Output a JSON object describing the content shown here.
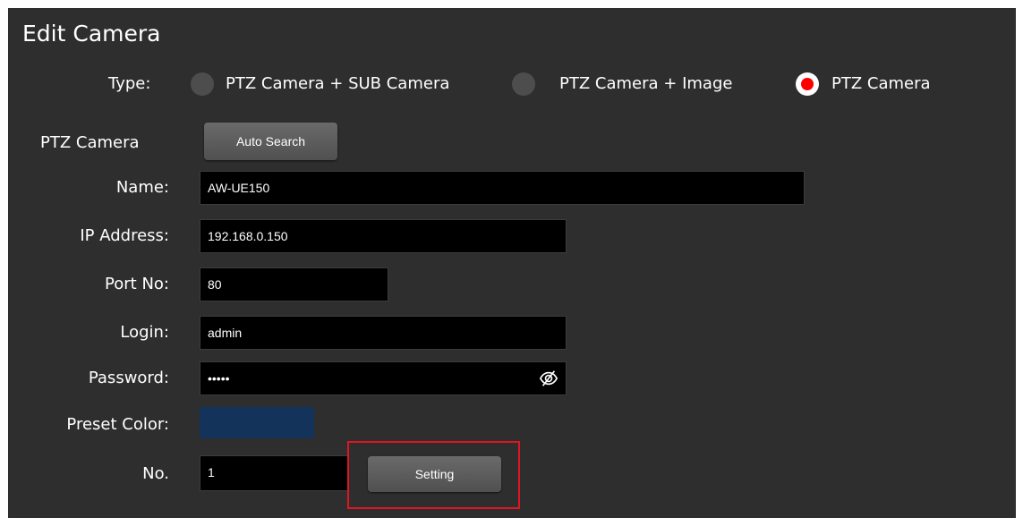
{
  "dialog": {
    "title": "Edit Camera"
  },
  "type": {
    "label": "Type:",
    "options": [
      {
        "label": "PTZ Camera + SUB Camera",
        "selected": false
      },
      {
        "label": "PTZ Camera + Image",
        "selected": false
      },
      {
        "label": "PTZ Camera",
        "selected": true
      }
    ]
  },
  "ptz_section": {
    "label": "PTZ Camera",
    "auto_search_label": "Auto Search"
  },
  "fields": {
    "name": {
      "label": "Name:",
      "value": "AW-UE150"
    },
    "ip_address": {
      "label": "IP Address:",
      "value": "192.168.0.150"
    },
    "port_no": {
      "label": "Port No:",
      "value": "80"
    },
    "login": {
      "label": "Login:",
      "value": "admin"
    },
    "password": {
      "label": "Password:",
      "value": "•••••",
      "icon": "eye-slash-icon"
    },
    "preset_color": {
      "label": "Preset Color:",
      "color": "#13335a"
    },
    "no": {
      "label": "No.",
      "value": "1"
    }
  },
  "setting_button": {
    "label": "Setting"
  },
  "colors": {
    "panel_bg": "#2e2e2e",
    "field_bg": "#000000",
    "radio_selected": "#ff0000",
    "highlight": "#e0151f"
  }
}
